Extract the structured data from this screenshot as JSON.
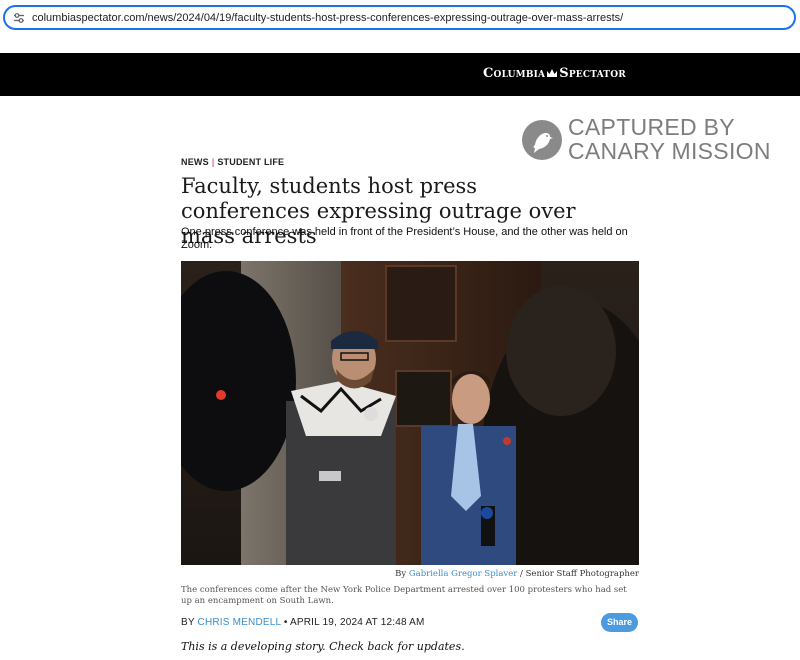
{
  "browser": {
    "url": "columbiaspectator.com/news/2024/04/19/faculty-students-host-press-conferences-expressing-outrage-over-mass-arrests/",
    "site_icon": "tune-icon"
  },
  "header": {
    "logo_text_left": "Columbia",
    "logo_text_right": "Spectator",
    "logo_icon": "crown-icon",
    "background": "#000000"
  },
  "watermark": {
    "line1": "CAPTURED BY",
    "line2": "CANARY MISSION",
    "icon": "canary-bird-icon"
  },
  "article": {
    "section": "NEWS",
    "subsection": "STUDENT LIFE",
    "headline": "Faculty, students host press conferences expressing outrage over mass arrests",
    "subheadline": "One press conference was held in front of the President’s House, and the other was held on Zoom.",
    "photo": {
      "credit_prefix": "By ",
      "photographer": "Gabriella Gregor Splaver",
      "credit_suffix": " / Senior Staff Photographer",
      "caption": "The conferences come after the New York Police Department arrested over 100 protesters who had set up an encampment on South Lawn."
    },
    "byline": {
      "prefix": "BY ",
      "author": "CHRIS MENDELL",
      "separator": " • ",
      "date": "APRIL 19, 2024 AT 12:48 AM"
    },
    "share_label": "Share",
    "developing_note": "This is a developing story. Check back for updates."
  },
  "colors": {
    "accent_link": "#3b8ec9",
    "share_button": "#4a9be0",
    "crumb_separator": "#c01f26"
  }
}
